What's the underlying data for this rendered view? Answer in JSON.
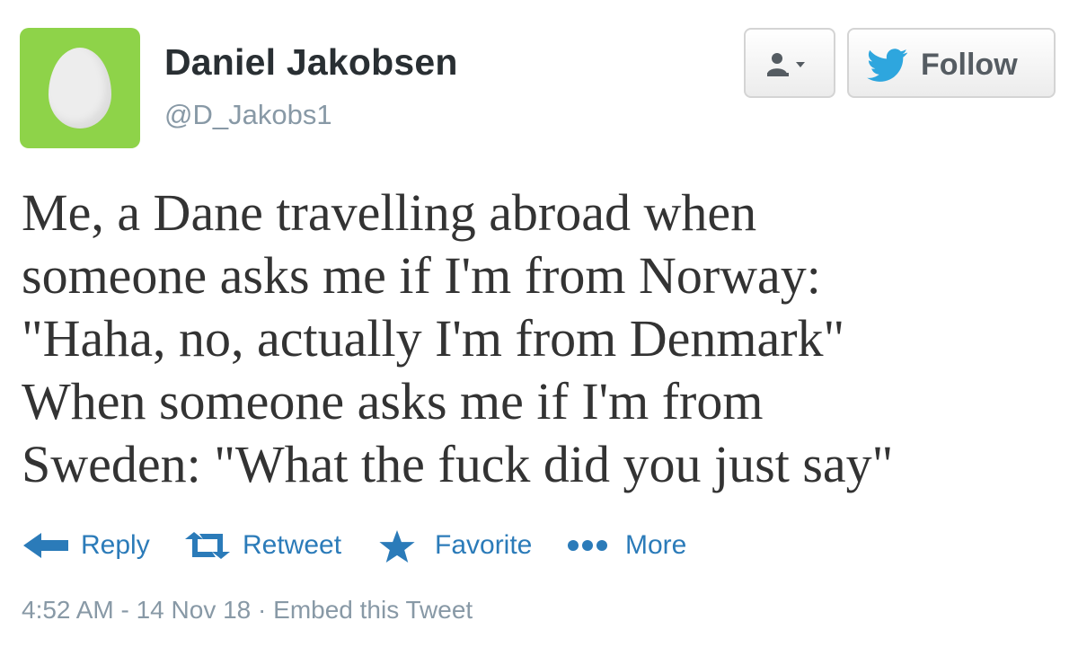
{
  "user": {
    "display_name": "Daniel Jakobsen",
    "handle": "@D_Jakobs1",
    "avatar_color": "#8ed349",
    "avatar_icon": "egg-avatar"
  },
  "buttons": {
    "user_dropdown_icon": "person-dropdown-icon",
    "follow_label": "Follow",
    "follow_icon": "twitter-bird-icon"
  },
  "tweet": {
    "lines": [
      "Me, a Dane travelling abroad when",
      "someone asks me if I'm from Norway:",
      "\"Haha, no, actually I'm from Denmark\"",
      "When someone asks me if I'm from",
      "Sweden: \"What the fuck did you just say\""
    ]
  },
  "actions": {
    "reply": "Reply",
    "retweet": "Retweet",
    "favorite": "Favorite",
    "more": "More"
  },
  "meta": {
    "time": "4:52 AM - 14 Nov 18",
    "separator": " · ",
    "embed": "Embed this Tweet"
  },
  "colors": {
    "link": "#2b7bb9",
    "muted": "#8899a6",
    "text": "#333333"
  }
}
